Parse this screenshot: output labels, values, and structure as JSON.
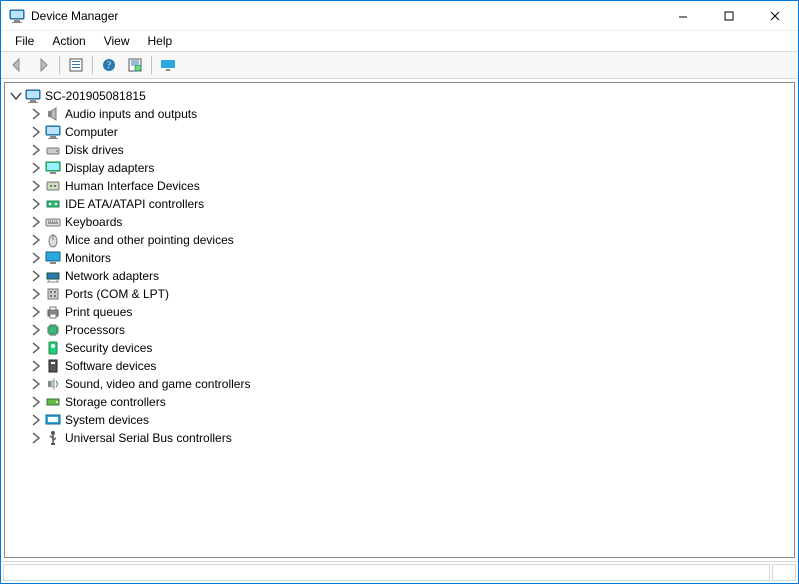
{
  "window": {
    "title": "Device Manager"
  },
  "menubar": {
    "file": "File",
    "action": "Action",
    "view": "View",
    "help": "Help"
  },
  "tree": {
    "root_label": "SC-201905081815",
    "items": [
      {
        "label": "Audio inputs and outputs",
        "icon": "speaker"
      },
      {
        "label": "Computer",
        "icon": "computer"
      },
      {
        "label": "Disk drives",
        "icon": "disk"
      },
      {
        "label": "Display adapters",
        "icon": "display"
      },
      {
        "label": "Human Interface Devices",
        "icon": "hid"
      },
      {
        "label": "IDE ATA/ATAPI controllers",
        "icon": "ide"
      },
      {
        "label": "Keyboards",
        "icon": "keyboard"
      },
      {
        "label": "Mice and other pointing devices",
        "icon": "mouse"
      },
      {
        "label": "Monitors",
        "icon": "monitor"
      },
      {
        "label": "Network adapters",
        "icon": "network"
      },
      {
        "label": "Ports (COM & LPT)",
        "icon": "ports"
      },
      {
        "label": "Print queues",
        "icon": "printer"
      },
      {
        "label": "Processors",
        "icon": "cpu"
      },
      {
        "label": "Security devices",
        "icon": "security"
      },
      {
        "label": "Software devices",
        "icon": "software"
      },
      {
        "label": "Sound, video and game controllers",
        "icon": "sound"
      },
      {
        "label": "Storage controllers",
        "icon": "storage"
      },
      {
        "label": "System devices",
        "icon": "system"
      },
      {
        "label": "Universal Serial Bus controllers",
        "icon": "usb"
      }
    ]
  }
}
